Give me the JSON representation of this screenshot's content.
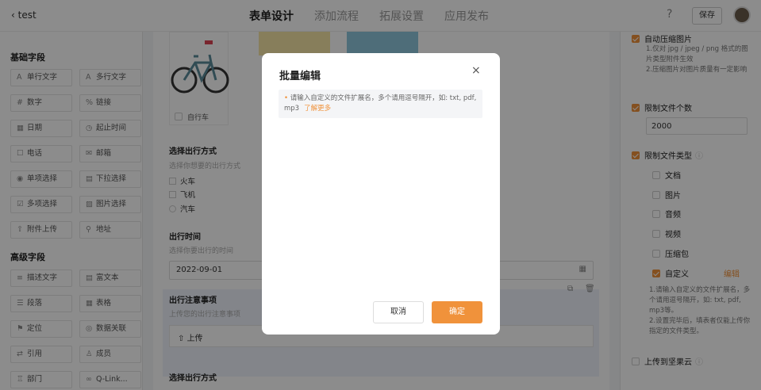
{
  "header": {
    "back_label": "test",
    "tabs": [
      "表单设计",
      "添加流程",
      "拓展设置",
      "应用发布"
    ],
    "help": "?",
    "save_label": "保存"
  },
  "left_panel": {
    "basic_title": "基础字段",
    "basic_fields": [
      {
        "icon": "A",
        "label": "单行文字"
      },
      {
        "icon": "A",
        "label": "多行文字"
      },
      {
        "icon": "#",
        "label": "数字"
      },
      {
        "icon": "%",
        "label": "链接"
      },
      {
        "icon": "▦",
        "label": "日期"
      },
      {
        "icon": "◷",
        "label": "起止时间"
      },
      {
        "icon": "☐",
        "label": "电话"
      },
      {
        "icon": "✉",
        "label": "邮箱"
      },
      {
        "icon": "◉",
        "label": "单项选择"
      },
      {
        "icon": "▤",
        "label": "下拉选择"
      },
      {
        "icon": "☑",
        "label": "多项选择"
      },
      {
        "icon": "▨",
        "label": "图片选择"
      },
      {
        "icon": "⇧",
        "label": "附件上传"
      },
      {
        "icon": "⚲",
        "label": "地址"
      }
    ],
    "advanced_title": "高级字段",
    "advanced_fields": [
      {
        "icon": "≡",
        "label": "描述文字"
      },
      {
        "icon": "▤",
        "label": "富文本"
      },
      {
        "icon": "☰",
        "label": "段落"
      },
      {
        "icon": "▦",
        "label": "表格"
      },
      {
        "icon": "⚑",
        "label": "定位"
      },
      {
        "icon": "◎",
        "label": "数据关联"
      },
      {
        "icon": "⇄",
        "label": "引用"
      },
      {
        "icon": "♙",
        "label": "成员"
      },
      {
        "icon": "♖",
        "label": "部门"
      },
      {
        "icon": "∞",
        "label": "Q-Link..."
      }
    ]
  },
  "middle": {
    "bike_label": "自行车",
    "section1_title": "选择出行方式",
    "section1_hint": "选择你想要的出行方式",
    "section1_options": [
      "火车",
      "飞机",
      "汽车"
    ],
    "date_title": "出行时间",
    "date_hint": "选择你要出行的时间",
    "date_value": "2022-09-01",
    "attach_title": "出行注意事项",
    "attach_hint": "上传您的出行注意事项",
    "upload_label": "上传",
    "section2_title": "选择出行方式"
  },
  "right_panel": {
    "auto_compress": "自动压缩图片",
    "compress_notes": [
      "1.仅对 jpg / jpeg / png 格式的图片类型附件生效",
      "2.压缩图片对图片质量有一定影响"
    ],
    "limit_count": "限制文件个数",
    "count_value": "2000",
    "limit_type": "限制文件类型",
    "types": [
      "文档",
      "图片",
      "音频",
      "视频",
      "压缩包",
      "自定义"
    ],
    "edit_label": "编辑",
    "custom_notes": [
      "1.请输入自定义的文件扩展名，多个请用逗号隔开，如: txt, pdf, mp3等。",
      "2.设置完毕后，填表者仅能上传你指定的文件类型。"
    ],
    "upload_cloud": "上传到坚果云"
  },
  "modal": {
    "title": "批量编辑",
    "close": "×",
    "tip_text": "请输入自定义的文件扩展名，多个请用逗号隔开，如: txt, pdf, mp3",
    "learn_more": "了解更多",
    "cancel": "取消",
    "confirm": "确定"
  },
  "colors": {
    "accent": "#f0923b",
    "overlay": "rgba(0,0,0,0.45)"
  }
}
